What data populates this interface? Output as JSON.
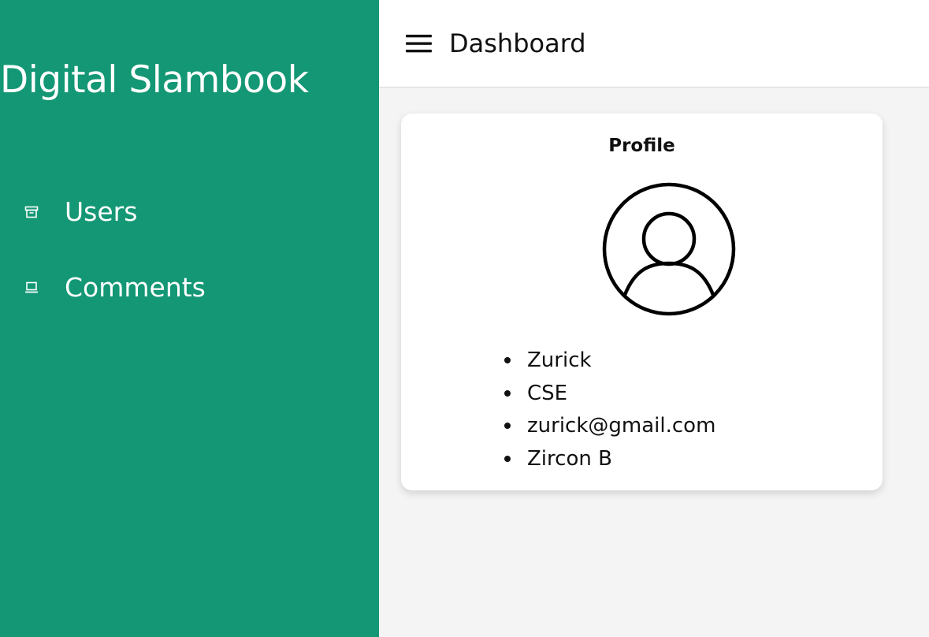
{
  "sidebar": {
    "brand": "Digital Slambook",
    "items": [
      {
        "label": "Users",
        "icon": "archive-icon"
      },
      {
        "label": "Comments",
        "icon": "laptop-icon"
      }
    ],
    "background": "#139774"
  },
  "header": {
    "menu_icon": "hamburger-menu-icon",
    "title": "Dashboard"
  },
  "profile_card": {
    "title": "Profile",
    "avatar_icon": "user-circle-icon",
    "details": [
      "Zurick",
      "CSE",
      "zurick@gmail.com",
      "Zircon B"
    ]
  }
}
